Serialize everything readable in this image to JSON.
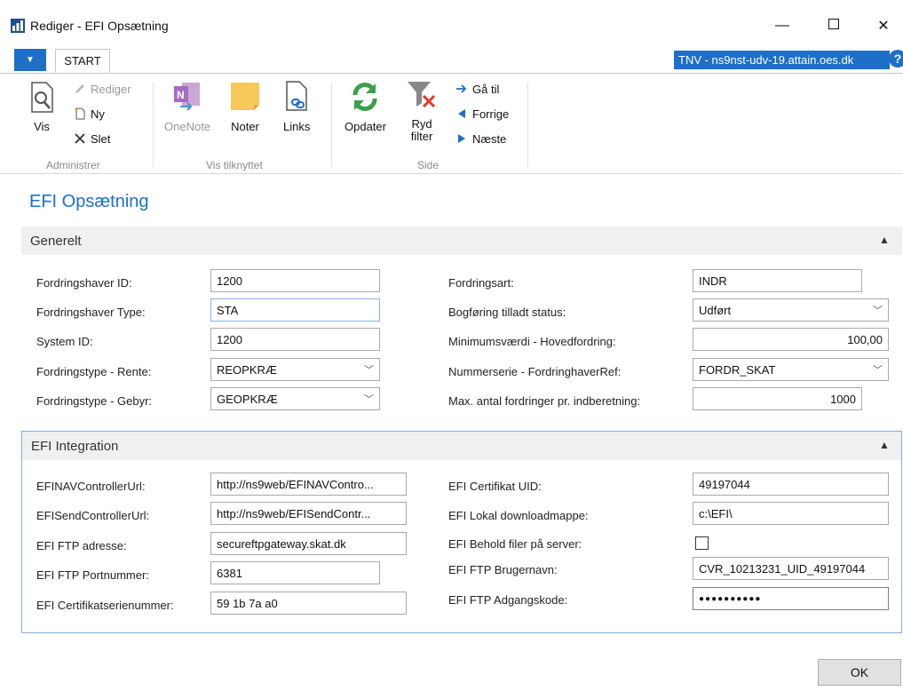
{
  "window": {
    "title": "Rediger - EFI Opsætning"
  },
  "ribbon": {
    "tab": "START",
    "server": "TNV - ns9nst-udv-19.attain.oes.dk",
    "help": "?",
    "groups": {
      "administrer": {
        "label": "Administrer",
        "vis": "Vis",
        "rediger": "Rediger",
        "ny": "Ny",
        "slet": "Slet"
      },
      "vis_tilknyttet": {
        "label": "Vis tilknyttet",
        "onenote": "OneNote",
        "noter": "Noter",
        "links": "Links"
      },
      "side": {
        "label": "Side",
        "opdater": "Opdater",
        "ryd_filter_1": "Ryd",
        "ryd_filter_2": "filter",
        "ga_til": "Gå til",
        "forrige": "Forrige",
        "naeste": "Næste"
      }
    }
  },
  "page": {
    "title": "EFI Opsætning"
  },
  "generelt": {
    "header": "Generelt",
    "left": [
      {
        "label": "Fordringshaver ID:",
        "value": "1200"
      },
      {
        "label": "Fordringshaver Type:",
        "value": "STA"
      },
      {
        "label": "System ID:",
        "value": "1200"
      },
      {
        "label": "Fordringstype - Rente:",
        "value": "REOPKRÆ"
      },
      {
        "label": "Fordringstype - Gebyr:",
        "value": "GEOPKRÆ"
      }
    ],
    "right": [
      {
        "label": "Fordringsart:",
        "value": "INDR"
      },
      {
        "label": "Bogføring tilladt status:",
        "value": "Udført"
      },
      {
        "label": "Minimumsværdi - Hovedfordring:",
        "value": "100,00"
      },
      {
        "label": "Nummerserie - FordringhaverRef:",
        "value": "FORDR_SKAT"
      },
      {
        "label": "Max. antal fordringer pr. indberetning:",
        "value": "1000"
      }
    ]
  },
  "integration": {
    "header": "EFI Integration",
    "left": [
      {
        "label": "EFINAVControllerUrl:",
        "value": "http://ns9web/EFINAVContro..."
      },
      {
        "label": "EFISendControllerUrl:",
        "value": "http://ns9web/EFISendContr..."
      },
      {
        "label": "EFI FTP adresse:",
        "value": "secureftpgateway.skat.dk"
      },
      {
        "label": "EFI FTP Portnummer:",
        "value": "6381"
      },
      {
        "label": "EFI Certifikatserienummer:",
        "value": "59 1b 7a a0"
      }
    ],
    "right": [
      {
        "label": "EFI Certifikat UID:",
        "value": "49197044"
      },
      {
        "label": "EFI Lokal downloadmappe:",
        "value": "c:\\EFI\\"
      },
      {
        "label": "EFI Behold filer på server:",
        "value": ""
      },
      {
        "label": "EFI FTP Brugernavn:",
        "value": "CVR_10213231_UID_49197044"
      },
      {
        "label": "EFI FTP Adgangskode:",
        "value": "●●●●●●●●●●"
      }
    ]
  },
  "footer": {
    "ok": "OK"
  },
  "colors": {
    "accent": "#1e6fc7",
    "section_bg": "#f0f0f0"
  }
}
